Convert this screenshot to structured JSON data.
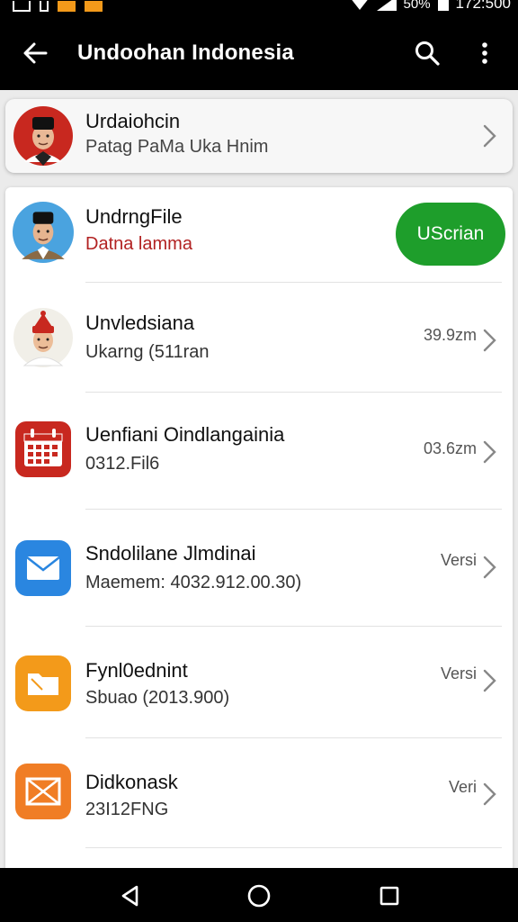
{
  "status_bar": {
    "battery_text": "50%",
    "time": "172:500"
  },
  "app_bar": {
    "title": "Undoohan Indonesia",
    "back_icon": "arrow-left-icon",
    "search_icon": "search-icon",
    "more_icon": "more-vert-icon"
  },
  "top_card": {
    "title": "Urdaiohcin",
    "subtitle": "Patag PaMa Uka Hnim",
    "icon": "avatar-man-peci"
  },
  "items": [
    {
      "title": "UndrngFile",
      "subtitle": "Datna lamma",
      "subtitle_color": "#b22222",
      "action_label": "UScrian",
      "icon": "avatar-man-peci-blue"
    },
    {
      "title": "Unvledsiana",
      "subtitle": "Ukarng (511ran",
      "meta": "39.9zm",
      "icon": "avatar-man-red-cap"
    },
    {
      "title": "Uenfiani Oindlangainia",
      "subtitle": "0312.Fil6",
      "meta": "03.6zm",
      "icon": "calendar-icon"
    },
    {
      "title": "Sndolilane Jlmdinai",
      "subtitle": "Maemem: 4032.912.00.30)",
      "meta": "Versi",
      "icon": "mail-icon"
    },
    {
      "title": "Fynl0ednint",
      "subtitle": "Sbuao (2013.900)",
      "meta": "Versi",
      "icon": "folder-icon"
    },
    {
      "title": "Didkonask",
      "subtitle": "23I12FNG",
      "meta": "Veri",
      "icon": "mail-open-icon"
    }
  ],
  "colors": {
    "accent_green": "#1e9e2b",
    "calendar_red": "#c8281f",
    "mail_blue": "#2a86e0",
    "folder_orange": "#f39a1a",
    "mail_orange": "#f07d25"
  },
  "nav_bar": {
    "back_icon": "nav-back-icon",
    "home_icon": "nav-home-icon",
    "recents_icon": "nav-recents-icon"
  }
}
